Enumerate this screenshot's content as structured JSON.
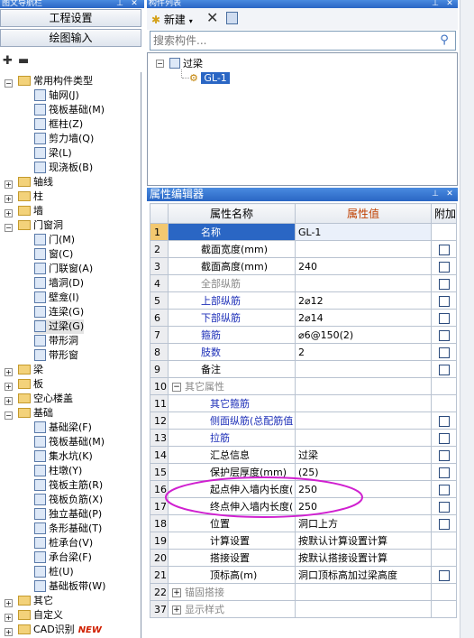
{
  "left_panel": {
    "title": "图文导航栏",
    "buttons": {
      "project_settings": "工程设置",
      "drawing_input": "绘图输入"
    },
    "tree": [
      {
        "label": "常用构件类型",
        "level": 0,
        "expander": "-",
        "kind": "folder"
      },
      {
        "label": "轴网(J)",
        "level": 1,
        "kind": "item",
        "icon": "grid-icon"
      },
      {
        "label": "筏板基础(M)",
        "level": 1,
        "kind": "item",
        "icon": "raft-icon"
      },
      {
        "label": "框柱(Z)",
        "level": 1,
        "kind": "item",
        "icon": "column-icon"
      },
      {
        "label": "剪力墙(Q)",
        "level": 1,
        "kind": "item",
        "icon": "wall-icon"
      },
      {
        "label": "梁(L)",
        "level": 1,
        "kind": "item",
        "icon": "beam-icon"
      },
      {
        "label": "现浇板(B)",
        "level": 1,
        "kind": "item",
        "icon": "slab-icon"
      },
      {
        "label": "轴线",
        "level": 0,
        "expander": "+",
        "kind": "folder"
      },
      {
        "label": "柱",
        "level": 0,
        "expander": "+",
        "kind": "folder"
      },
      {
        "label": "墙",
        "level": 0,
        "expander": "+",
        "kind": "folder"
      },
      {
        "label": "门窗洞",
        "level": 0,
        "expander": "-",
        "kind": "folder"
      },
      {
        "label": "门(M)",
        "level": 1,
        "kind": "item",
        "icon": "door-icon"
      },
      {
        "label": "窗(C)",
        "level": 1,
        "kind": "item",
        "icon": "window-icon"
      },
      {
        "label": "门联窗(A)",
        "level": 1,
        "kind": "item",
        "icon": "door-window-icon"
      },
      {
        "label": "墙洞(D)",
        "level": 1,
        "kind": "item",
        "icon": "wall-hole-icon"
      },
      {
        "label": "壁龛(I)",
        "level": 1,
        "kind": "item",
        "icon": "niche-icon"
      },
      {
        "label": "连梁(G)",
        "level": 1,
        "kind": "item",
        "icon": "link-beam-icon"
      },
      {
        "label": "过梁(G)",
        "level": 1,
        "kind": "item",
        "icon": "lintel-icon",
        "selected": true
      },
      {
        "label": "带形洞",
        "level": 1,
        "kind": "item",
        "icon": "strip-hole-icon"
      },
      {
        "label": "带形窗",
        "level": 1,
        "kind": "item",
        "icon": "strip-window-icon"
      },
      {
        "label": "梁",
        "level": 0,
        "expander": "+",
        "kind": "folder"
      },
      {
        "label": "板",
        "level": 0,
        "expander": "+",
        "kind": "folder"
      },
      {
        "label": "空心楼盖",
        "level": 0,
        "expander": "+",
        "kind": "folder"
      },
      {
        "label": "基础",
        "level": 0,
        "expander": "-",
        "kind": "folder"
      },
      {
        "label": "基础梁(F)",
        "level": 1,
        "kind": "item",
        "icon": "foundation-beam-icon"
      },
      {
        "label": "筏板基础(M)",
        "level": 1,
        "kind": "item",
        "icon": "raft-icon"
      },
      {
        "label": "集水坑(K)",
        "level": 1,
        "kind": "item",
        "icon": "sump-icon"
      },
      {
        "label": "柱墩(Y)",
        "level": 1,
        "kind": "item",
        "icon": "pier-icon"
      },
      {
        "label": "筏板主筋(R)",
        "level": 1,
        "kind": "item",
        "icon": "rebar-icon"
      },
      {
        "label": "筏板负筋(X)",
        "level": 1,
        "kind": "item",
        "icon": "rebar-icon"
      },
      {
        "label": "独立基础(P)",
        "level": 1,
        "kind": "item",
        "icon": "isolated-footing-icon"
      },
      {
        "label": "条形基础(T)",
        "level": 1,
        "kind": "item",
        "icon": "strip-footing-icon"
      },
      {
        "label": "桩承台(V)",
        "level": 1,
        "kind": "item",
        "icon": "pile-cap-icon"
      },
      {
        "label": "承台梁(F)",
        "level": 1,
        "kind": "item",
        "icon": "cap-beam-icon"
      },
      {
        "label": "桩(U)",
        "level": 1,
        "kind": "item",
        "icon": "pile-icon"
      },
      {
        "label": "基础板带(W)",
        "level": 1,
        "kind": "item",
        "icon": "slab-strip-icon"
      },
      {
        "label": "其它",
        "level": 0,
        "expander": "+",
        "kind": "folder"
      },
      {
        "label": "自定义",
        "level": 0,
        "expander": "+",
        "kind": "folder"
      },
      {
        "label": "CAD识别",
        "level": 0,
        "expander": "+",
        "kind": "folder",
        "badge": "NEW"
      }
    ]
  },
  "component_list": {
    "title": "构件列表",
    "new_button": "新建",
    "search_placeholder": "搜索构件...",
    "tree_root": "过梁",
    "tree_child": "GL-1"
  },
  "property_editor": {
    "title": "属性编辑器",
    "columns": {
      "name": "属性名称",
      "value": "属性值",
      "extra": "附加"
    },
    "rows": [
      {
        "num": "1",
        "name": "名称",
        "value": "GL-1",
        "style": "normal",
        "checkbox": false,
        "highlight": true
      },
      {
        "num": "2",
        "name": "截面宽度(mm)",
        "value": "",
        "style": "normal",
        "checkbox": true
      },
      {
        "num": "3",
        "name": "截面高度(mm)",
        "value": "240",
        "style": "normal",
        "checkbox": true
      },
      {
        "num": "4",
        "name": "全部纵筋",
        "value": "",
        "style": "gray",
        "checkbox": true
      },
      {
        "num": "5",
        "name": "上部纵筋",
        "value": "2⌀12",
        "style": "blue",
        "checkbox": true
      },
      {
        "num": "6",
        "name": "下部纵筋",
        "value": "2⌀14",
        "style": "blue",
        "checkbox": true
      },
      {
        "num": "7",
        "name": "箍筋",
        "value": "⌀6@150(2)",
        "style": "blue",
        "checkbox": true
      },
      {
        "num": "8",
        "name": "肢数",
        "value": "2",
        "style": "blue",
        "checkbox": true
      },
      {
        "num": "9",
        "name": "备注",
        "value": "",
        "style": "normal",
        "checkbox": true
      },
      {
        "num": "10",
        "name": "其它属性",
        "value": "",
        "style": "group",
        "expander": "-",
        "checkbox": false
      },
      {
        "num": "11",
        "name": "其它箍筋",
        "value": "",
        "style": "blue-sub",
        "checkbox": false
      },
      {
        "num": "12",
        "name": "侧面纵筋(总配筋值",
        "value": "",
        "style": "blue-sub",
        "checkbox": true
      },
      {
        "num": "13",
        "name": "拉筋",
        "value": "",
        "style": "blue-sub",
        "checkbox": true
      },
      {
        "num": "14",
        "name": "汇总信息",
        "value": "过梁",
        "style": "sub",
        "checkbox": true
      },
      {
        "num": "15",
        "name": "保护层厚度(mm)",
        "value": "(25)",
        "style": "sub",
        "checkbox": true
      },
      {
        "num": "16",
        "name": "起点伸入墙内长度(",
        "value": "250",
        "style": "sub",
        "checkbox": true
      },
      {
        "num": "17",
        "name": "终点伸入墙内长度(",
        "value": "250",
        "style": "sub",
        "checkbox": true
      },
      {
        "num": "18",
        "name": "位置",
        "value": "洞口上方",
        "style": "sub",
        "checkbox": true
      },
      {
        "num": "19",
        "name": "计算设置",
        "value": "按默认计算设置计算",
        "style": "sub",
        "checkbox": false
      },
      {
        "num": "20",
        "name": "搭接设置",
        "value": "按默认搭接设置计算",
        "style": "sub",
        "checkbox": false
      },
      {
        "num": "21",
        "name": "顶标高(m)",
        "value": "洞口顶标高加过梁高度",
        "style": "sub",
        "checkbox": true
      },
      {
        "num": "22",
        "name": "锚固搭接",
        "value": "",
        "style": "group",
        "expander": "+",
        "checkbox": false
      },
      {
        "num": "37",
        "name": "显示样式",
        "value": "",
        "style": "group",
        "expander": "+",
        "checkbox": false
      }
    ]
  },
  "colors": {
    "accent": "#2a66c4",
    "link": "#1d2fb8",
    "annotation": "#d020d0",
    "value_header": "#c04000"
  }
}
